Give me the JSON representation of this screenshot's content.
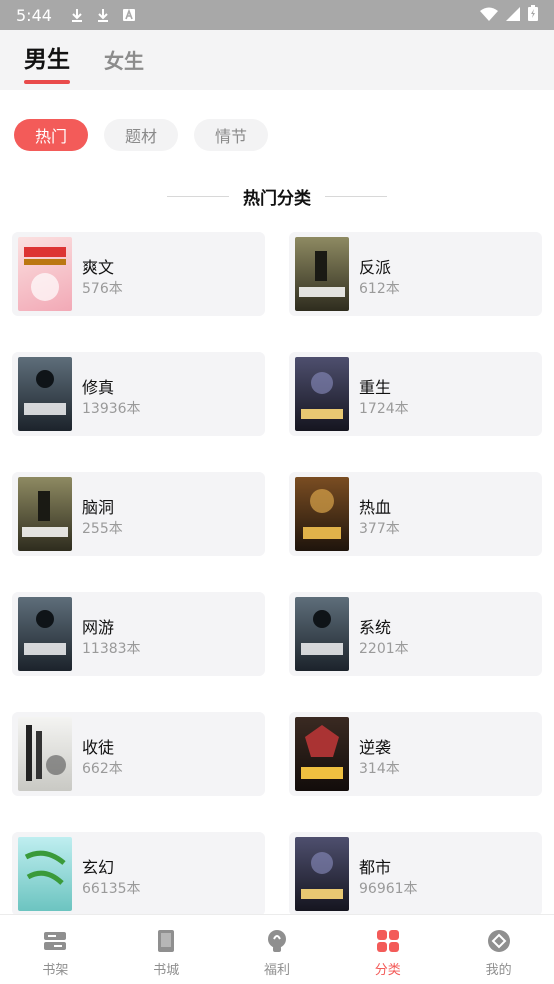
{
  "status_bar": {
    "time": "5:44"
  },
  "top_tabs": [
    {
      "label": "男生",
      "active": true
    },
    {
      "label": "女生",
      "active": false
    }
  ],
  "filter_chips": [
    {
      "label": "热门",
      "active": true
    },
    {
      "label": "题材",
      "active": false
    },
    {
      "label": "情节",
      "active": false
    }
  ],
  "section_title": "热门分类",
  "categories": [
    {
      "name": "爽文",
      "count": "576本",
      "cover_color": "#f6c6c6"
    },
    {
      "name": "反派",
      "count": "612本",
      "cover_color": "#4c4a33"
    },
    {
      "name": "修真",
      "count": "13936本",
      "cover_color": "#2c3440"
    },
    {
      "name": "重生",
      "count": "1724本",
      "cover_color": "#2b2c3a"
    },
    {
      "name": "脑洞",
      "count": "255本",
      "cover_color": "#4c4a33"
    },
    {
      "name": "热血",
      "count": "377本",
      "cover_color": "#3a2a1a"
    },
    {
      "name": "网游",
      "count": "11383本",
      "cover_color": "#2c3440"
    },
    {
      "name": "系统",
      "count": "2201本",
      "cover_color": "#2c3440"
    },
    {
      "name": "收徒",
      "count": "662本",
      "cover_color": "#e8e8e6"
    },
    {
      "name": "逆袭",
      "count": "314本",
      "cover_color": "#2a2222"
    },
    {
      "name": "玄幻",
      "count": "66135本",
      "cover_color": "#9ad6d6"
    },
    {
      "name": "都市",
      "count": "96961本",
      "cover_color": "#2b2c3a"
    }
  ],
  "bottom_nav": [
    {
      "label": "书架",
      "icon": "bookshelf-icon",
      "active": false
    },
    {
      "label": "书城",
      "icon": "book-icon",
      "active": false
    },
    {
      "label": "福利",
      "icon": "gift-icon",
      "active": false
    },
    {
      "label": "分类",
      "icon": "category-icon",
      "active": true
    },
    {
      "label": "我的",
      "icon": "profile-icon",
      "active": false
    }
  ],
  "colors": {
    "accent": "#f35b59",
    "status_bar": "#a8a8a8",
    "card_bg": "#f4f4f6"
  }
}
